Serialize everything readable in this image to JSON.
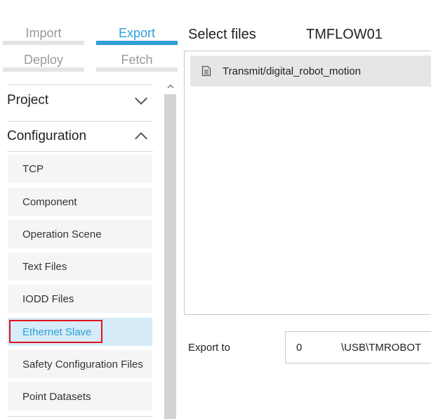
{
  "tabs": {
    "import": "Import",
    "export": "Export",
    "deploy": "Deploy",
    "fetch": "Fetch"
  },
  "sidebar": {
    "sections": {
      "project": "Project",
      "configuration": "Configuration"
    },
    "items": [
      "TCP",
      "Component",
      "Operation Scene",
      "Text Files",
      "IODD Files",
      "Ethernet Slave",
      "Safety Configuration Files",
      "Point Datasets"
    ],
    "selected_item": "Ethernet Slave"
  },
  "main": {
    "title": "Select files",
    "flow_name": "TMFLOW01",
    "files": [
      "Transmit/digital_robot_motion"
    ],
    "export_label": "Export to",
    "export_index": "0",
    "export_path": "\\USB\\TMROBOT"
  },
  "colors": {
    "accent": "#2e9fd8",
    "selected_bg": "#d6ecf8",
    "highlight_box": "#e0121b"
  }
}
